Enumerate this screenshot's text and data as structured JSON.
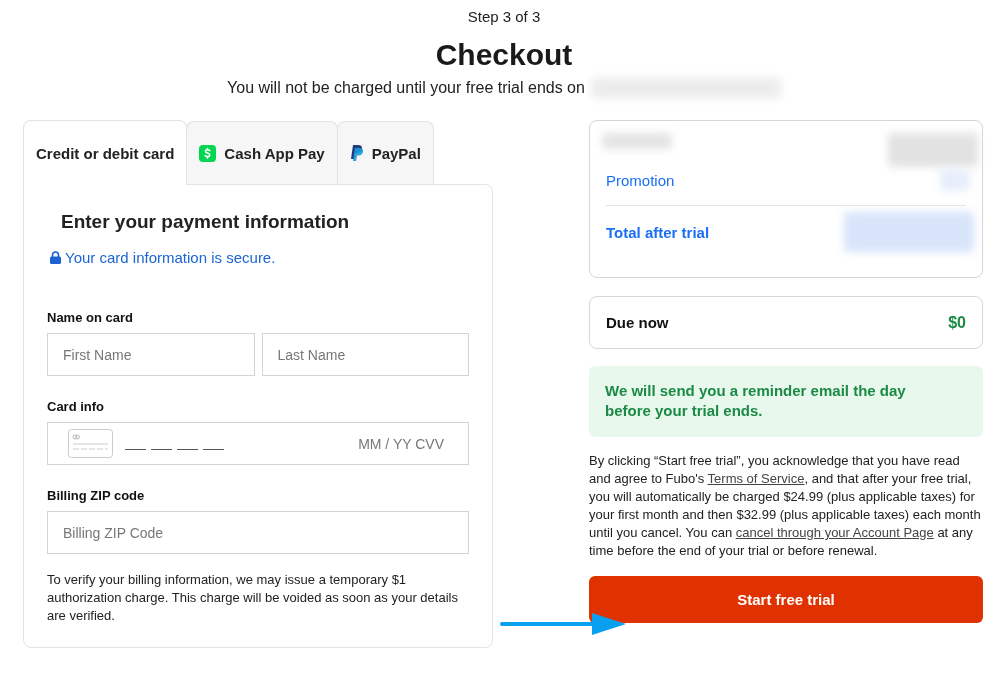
{
  "header": {
    "step": "Step 3 of 3",
    "title": "Checkout",
    "subtitle": "You will not be charged until your free trial ends on"
  },
  "payment_tabs": [
    {
      "label": "Credit or debit card",
      "selected": true,
      "kind": "card"
    },
    {
      "label": "Cash App Pay",
      "selected": false,
      "kind": "cashapp"
    },
    {
      "label": "PayPal",
      "selected": false,
      "kind": "paypal"
    }
  ],
  "payment_form": {
    "heading": "Enter your payment information",
    "secure_note": "Your card information is secure.",
    "name_label": "Name on card",
    "first_name": {
      "placeholder": "First Name"
    },
    "last_name": {
      "placeholder": "Last Name"
    },
    "card_label": "Card info",
    "card_expiry_cvv": {
      "placeholder": "MM / YY CVV"
    },
    "zip_label": "Billing ZIP code",
    "zip": {
      "placeholder": "Billing ZIP Code"
    },
    "verification_note": "To verify your billing information, we may issue a temporary $1 authorization charge. This charge will be voided as soon as your details are verified."
  },
  "summary": {
    "rows": [
      {
        "label": "Promotion",
        "bold": false
      },
      {
        "label": "Total after trial",
        "bold": true
      }
    ]
  },
  "due_now": {
    "label": "Due now",
    "amount": "$0"
  },
  "reminder": "We will send you a reminder email the day before your trial ends.",
  "legal": {
    "before": "By clicking “Start free trial”, you acknowledge that you have read and agree to Fubo's ",
    "terms_link": "Terms of Service",
    "middle": ", and that after your free trial, you will automatically be charged $24.99 (plus applicable taxes) for your first month and then $32.99 (plus applicable taxes) each month until you cancel. You can ",
    "cancel_link": "cancel through your Account Page",
    "after": " at any time before the end of your trial or before renewal."
  },
  "submit_button": "Start free trial"
}
